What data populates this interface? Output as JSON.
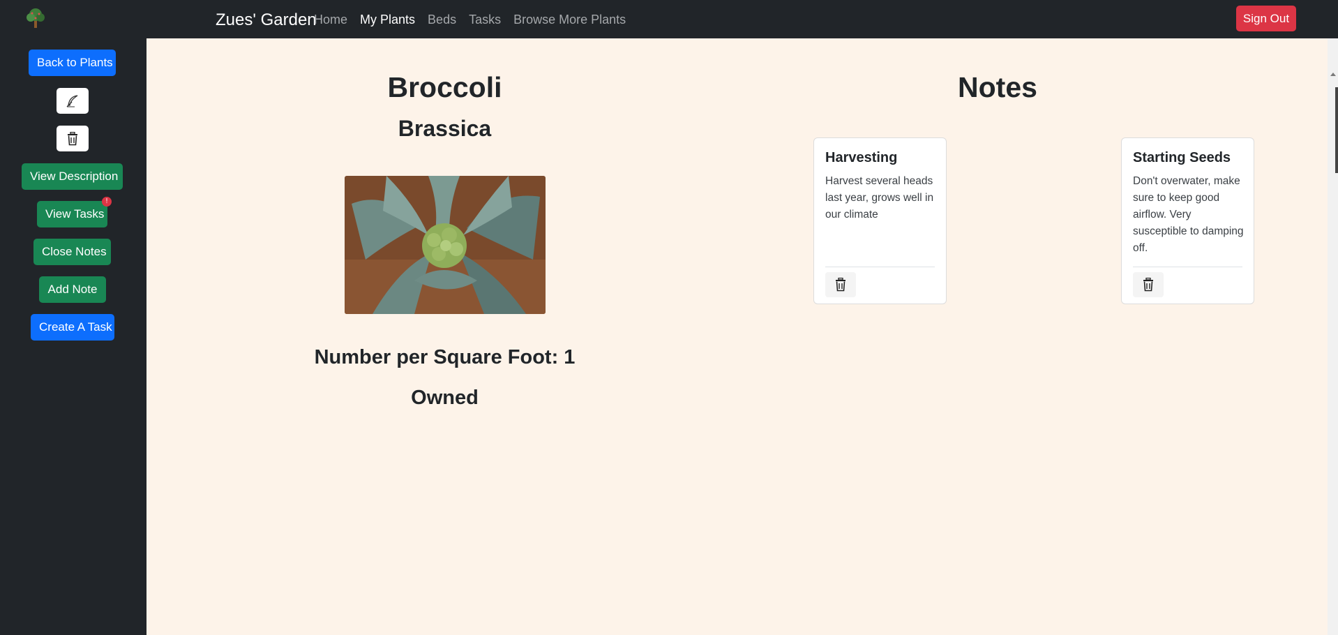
{
  "navbar": {
    "brand": "Zues' Garden",
    "links": [
      {
        "label": "Home",
        "active": false
      },
      {
        "label": "My Plants",
        "active": true
      },
      {
        "label": "Beds",
        "active": false
      },
      {
        "label": "Tasks",
        "active": false
      },
      {
        "label": "Browse More Plants",
        "active": false
      }
    ],
    "sign_out": "Sign Out",
    "logo_icon": "tree-icon"
  },
  "sidebar": {
    "back": "Back to Plants",
    "edit_icon": "feather-pen-icon",
    "delete_icon": "trash-icon",
    "view_description": "View Description",
    "view_tasks": "View Tasks",
    "tasks_badge": "!",
    "close_notes": "Close Notes",
    "add_note": "Add Note",
    "create_task": "Create A Task"
  },
  "plant": {
    "name": "Broccoli",
    "family": "Brassica",
    "spacing": "Number per Square Foot: 1",
    "status": "Owned"
  },
  "notes": {
    "title": "Notes",
    "items": [
      {
        "title": "Harvesting",
        "body": "Harvest several heads last year, grows well in our climate"
      },
      {
        "title": "Starting Seeds",
        "body": "Don't overwater, make sure to keep good airflow. Very susceptible to damping off."
      }
    ]
  },
  "colors": {
    "navbar": "#212529",
    "page_bg": "#fdf3e9",
    "primary": "#0d6efd",
    "success": "#198754",
    "danger": "#dc3545"
  }
}
